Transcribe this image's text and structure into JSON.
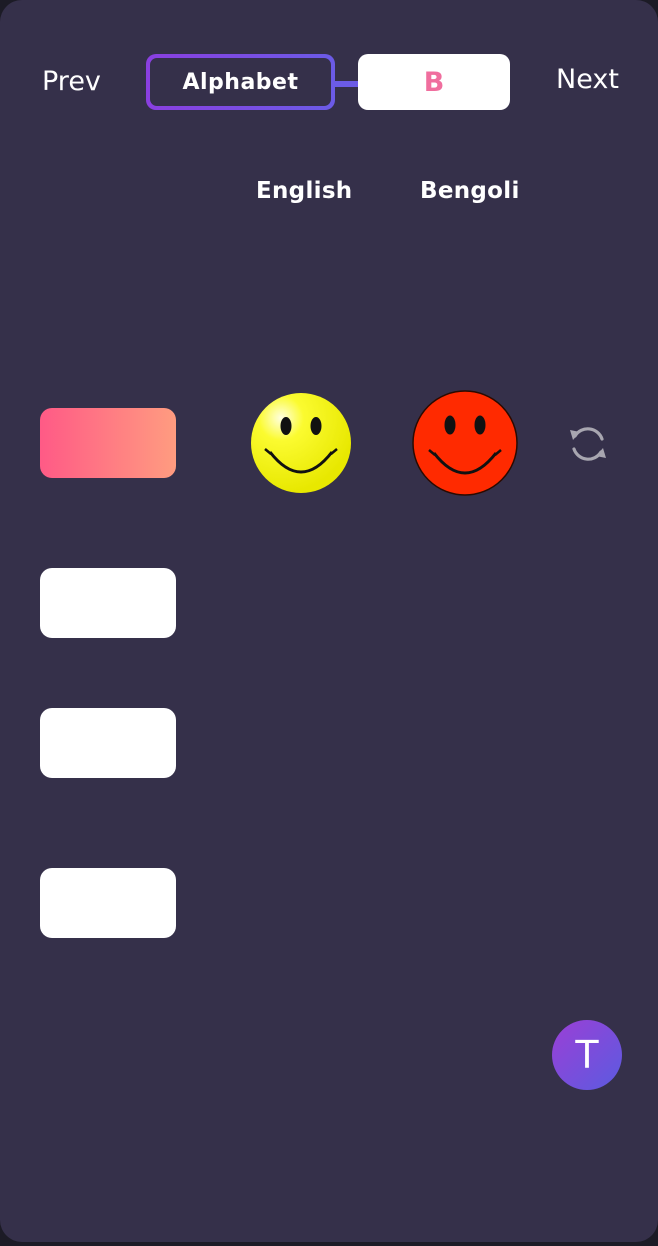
{
  "nav": {
    "prev_label": "Prev",
    "next_label": "Next"
  },
  "topic": {
    "label": "Alphabet",
    "letter": "B"
  },
  "columns": {
    "english": "English",
    "bengali": "Bengoli"
  },
  "options": [
    {
      "label": "",
      "selected": true
    },
    {
      "label": "",
      "selected": false
    },
    {
      "label": "",
      "selected": false
    },
    {
      "label": "",
      "selected": false
    }
  ],
  "icons": {
    "english_indicator": "smiley-yellow-icon",
    "bengali_indicator": "smiley-red-icon",
    "refresh": "refresh-icon"
  },
  "fab": {
    "label": "T"
  },
  "colors": {
    "background": "#35304a",
    "accent_purple": "#8a3fe0",
    "letter_pink": "#f06e9e",
    "selected_gradient_start": "#ff5a86",
    "selected_gradient_end": "#ff9c80",
    "smiley_yellow": "#f7f500",
    "smiley_red": "#ff2a00"
  }
}
